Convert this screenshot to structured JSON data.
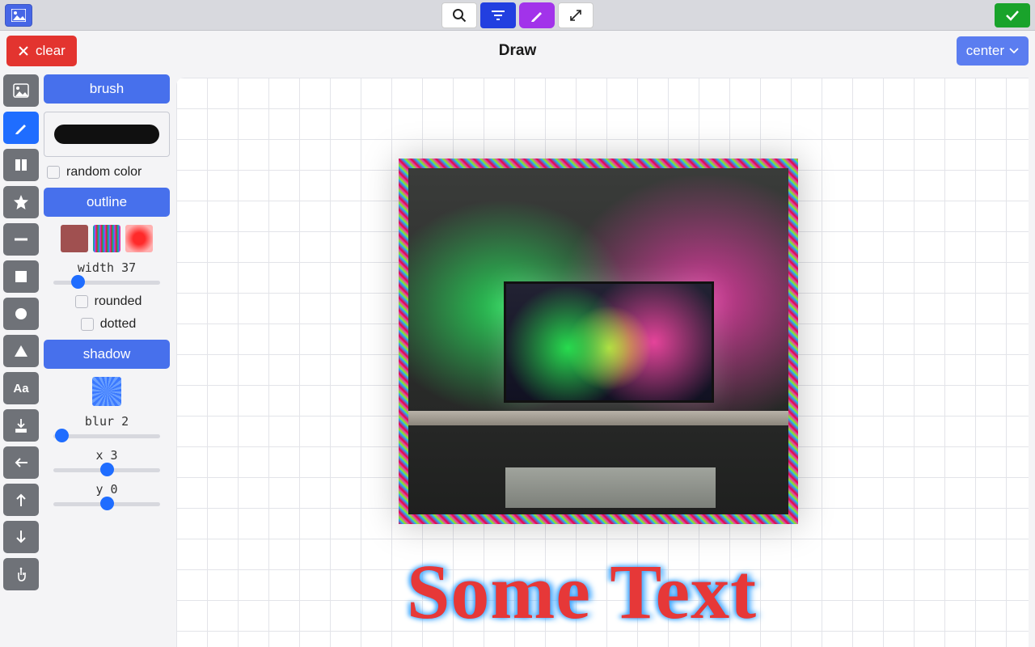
{
  "title": "Draw",
  "topbar": {
    "logo_icon": "image-icon",
    "search_icon": "search-icon",
    "filter_icon": "filter-icon",
    "brush_icon": "brush-icon",
    "expand_icon": "expand-icon",
    "confirm_icon": "check-icon"
  },
  "clear_label": "clear",
  "align_dropdown": {
    "value": "center"
  },
  "tools": [
    "image",
    "brush",
    "columns",
    "star",
    "minus",
    "square",
    "circle",
    "triangle",
    "text",
    "download",
    "arrow-left",
    "arrow-up",
    "arrow-down",
    "pointer"
  ],
  "active_tool_index": 1,
  "panel": {
    "brush_head": "brush",
    "random_color_label": "random color",
    "outline_head": "outline",
    "width_label": "width",
    "width_value": 37,
    "rounded_label": "rounded",
    "dotted_label": "dotted",
    "shadow_head": "shadow",
    "blur_label": "blur",
    "blur_value": 2,
    "x_label": "x",
    "x_value": 3,
    "y_label": "y",
    "y_value": 0
  },
  "canvas": {
    "sample_text": "Some Text"
  }
}
